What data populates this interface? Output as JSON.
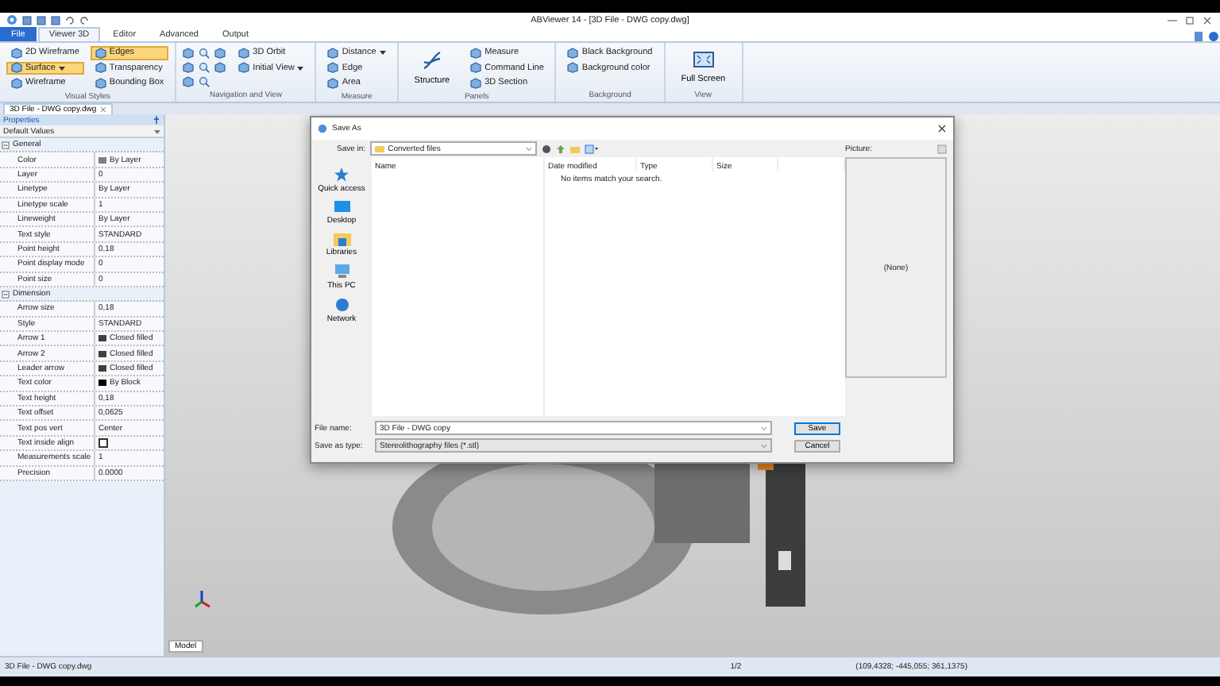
{
  "window": {
    "title": "ABViewer 14 - [3D File - DWG copy.dwg]"
  },
  "menu_tabs": [
    {
      "label": "File",
      "kind": "file",
      "selected": false
    },
    {
      "label": "Viewer 3D",
      "kind": "tab",
      "selected": true
    },
    {
      "label": "Editor",
      "kind": "tab",
      "selected": false
    },
    {
      "label": "Advanced",
      "kind": "tab",
      "selected": false
    },
    {
      "label": "Output",
      "kind": "tab",
      "selected": false
    }
  ],
  "ribbon": [
    {
      "title": "Visual Styles",
      "columns": [
        [
          {
            "label": "2D Wireframe",
            "selected": false,
            "dropdown": false
          },
          {
            "label": "Surface",
            "selected": true,
            "dropdown": true
          },
          {
            "label": "Wireframe",
            "selected": false,
            "dropdown": false
          }
        ],
        [
          {
            "label": "Edges",
            "selected": true,
            "dropdown": false
          },
          {
            "label": "Transparency",
            "selected": false,
            "dropdown": false
          },
          {
            "label": "Bounding Box",
            "selected": false,
            "dropdown": false
          }
        ]
      ]
    },
    {
      "title": "Navigation and View",
      "columns": [
        [
          {
            "label": "3D Orbit",
            "selected": false,
            "dropdown": false
          },
          {
            "label": "Initial View",
            "selected": false,
            "dropdown": true
          }
        ]
      ]
    },
    {
      "title": "Measure",
      "columns": [
        [
          {
            "label": "Distance",
            "selected": false,
            "dropdown": true
          },
          {
            "label": "Edge",
            "selected": false,
            "dropdown": false
          },
          {
            "label": "Area",
            "selected": false,
            "dropdown": false
          }
        ]
      ]
    },
    {
      "title": "Panels",
      "large": "Structure",
      "columns": [
        [
          {
            "label": "Measure",
            "selected": false,
            "dropdown": false
          },
          {
            "label": "Command Line",
            "selected": false,
            "dropdown": false
          },
          {
            "label": "3D Section",
            "selected": false,
            "dropdown": false
          }
        ]
      ]
    },
    {
      "title": "Background",
      "columns": [
        [
          {
            "label": "Black Background",
            "selected": false,
            "dropdown": false
          },
          {
            "label": "Background color",
            "selected": false,
            "dropdown": false
          }
        ]
      ]
    },
    {
      "title": "View",
      "large": "Full Screen"
    }
  ],
  "document_tab": "3D File - DWG copy.dwg",
  "properties": {
    "title": "Properties",
    "filter": "Default Values",
    "sections": [
      {
        "title": "General",
        "expanded": true,
        "rows": [
          {
            "name": "Color",
            "value": "By Layer",
            "kind": "swatch",
            "color": "#808080"
          },
          {
            "name": "Layer",
            "value": "0",
            "kind": "text"
          },
          {
            "name": "Linetype",
            "value": "By Layer",
            "kind": "text"
          },
          {
            "name": "Linetype scale",
            "value": "1",
            "kind": "text"
          },
          {
            "name": "Lineweight",
            "value": "By Layer",
            "kind": "text"
          },
          {
            "name": "Text style",
            "value": "STANDARD",
            "kind": "text"
          },
          {
            "name": "Point height",
            "value": "0,18",
            "kind": "text"
          },
          {
            "name": "Point display mode",
            "value": "0",
            "kind": "text"
          },
          {
            "name": "Point size",
            "value": "0",
            "kind": "text"
          }
        ]
      },
      {
        "title": "Dimension",
        "expanded": true,
        "rows": [
          {
            "name": "Arrow size",
            "value": "0,18",
            "kind": "text"
          },
          {
            "name": "Style",
            "value": "STANDARD",
            "kind": "text"
          },
          {
            "name": "Arrow 1",
            "value": "Closed filled",
            "kind": "swatch",
            "color": "#404040"
          },
          {
            "name": "Arrow 2",
            "value": "Closed filled",
            "kind": "swatch",
            "color": "#404040"
          },
          {
            "name": "Leader arrow",
            "value": "Closed filled",
            "kind": "swatch",
            "color": "#404040"
          },
          {
            "name": "Text color",
            "value": "By Block",
            "kind": "swatch",
            "color": "#000000"
          },
          {
            "name": "Text height",
            "value": "0,18",
            "kind": "text"
          },
          {
            "name": "Text offset",
            "value": "0,0625",
            "kind": "text"
          },
          {
            "name": "Text pos vert",
            "value": "Center",
            "kind": "text"
          },
          {
            "name": "Text inside align",
            "kind": "checkbox",
            "checked": false
          },
          {
            "name": "Measurements scale",
            "value": "1",
            "kind": "text"
          },
          {
            "name": "Precision",
            "value": "0.0000",
            "kind": "text"
          }
        ]
      }
    ]
  },
  "viewport": {
    "layout_tab": "Model"
  },
  "dialog": {
    "title": "Save As",
    "save_in_label": "Save in:",
    "save_in": "Converted files",
    "places": [
      "Quick access",
      "Desktop",
      "Libraries",
      "This PC",
      "Network"
    ],
    "columns": [
      "Name",
      "Date modified",
      "Type",
      "Size"
    ],
    "empty_message": "No items match your search.",
    "picture_label": "Picture:",
    "preview": "(None)",
    "file_name_label": "File name:",
    "file_name": "3D File - DWG copy",
    "type_label": "Save as type:",
    "type": "Stereolithography files (*.stl)",
    "buttons": [
      "Save",
      "Cancel"
    ]
  },
  "status_bar": {
    "file": "3D File - DWG copy.dwg",
    "page": "1/2",
    "coordinates": "(109,4328; -445,055; 361,1375)"
  }
}
